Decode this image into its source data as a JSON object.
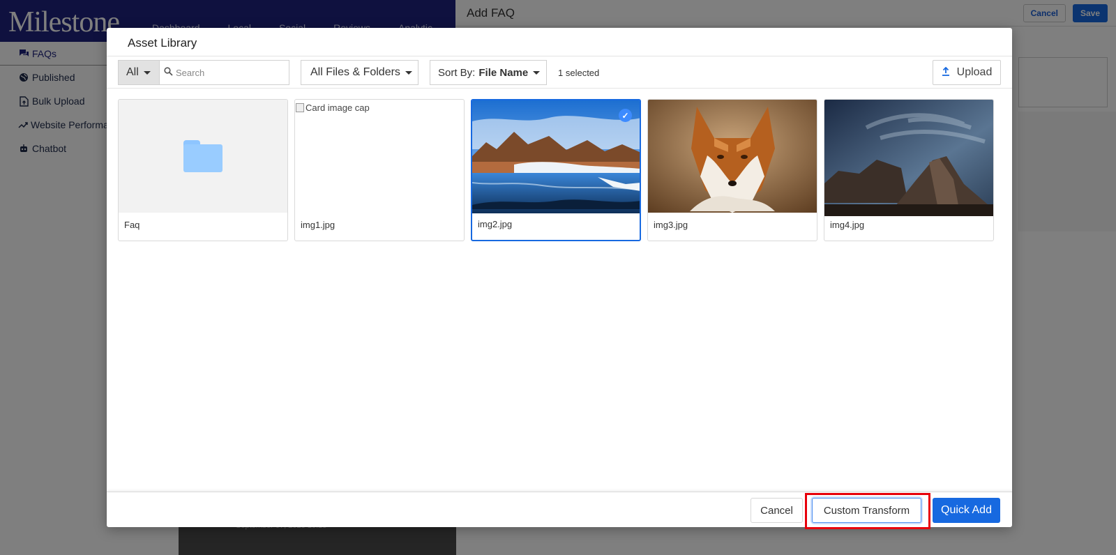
{
  "app": {
    "logo": "Milestone",
    "topnav": [
      "Dashboard",
      "Local",
      "Social",
      "Reviews",
      "Analytic"
    ],
    "sidebar": [
      {
        "label": "FAQs",
        "icon": "chat-icon"
      },
      {
        "label": "Published",
        "icon": "globe-icon"
      },
      {
        "label": "Bulk Upload",
        "icon": "file-upload-icon"
      },
      {
        "label": "Website Performan",
        "icon": "trending-icon"
      },
      {
        "label": "Chatbot",
        "icon": "robot-icon"
      }
    ],
    "faq_title": "Add FAQ",
    "faq_cancel": "Cancel",
    "faq_save": "Save",
    "bottom_text": "September 07, 2023 10:18"
  },
  "modal": {
    "title": "Asset Library",
    "filter_all": "All",
    "search_placeholder": "Search",
    "folder_filter": "All Files & Folders",
    "sort_prefix": "Sort By:",
    "sort_value": "File Name",
    "selected_count": "1 selected",
    "upload_label": "Upload",
    "assets": [
      {
        "name": "Faq",
        "kind": "folder"
      },
      {
        "name": "img1.jpg",
        "kind": "broken-image",
        "alt": "Card image cap"
      },
      {
        "name": "img2.jpg",
        "kind": "image",
        "selected": true
      },
      {
        "name": "img3.jpg",
        "kind": "image"
      },
      {
        "name": "img4.jpg",
        "kind": "image"
      }
    ],
    "footer": {
      "cancel": "Cancel",
      "custom_transform": "Custom Transform",
      "quick_add": "Quick Add"
    }
  },
  "colors": {
    "brand_navy": "#1f237f",
    "primary_blue": "#1769e0",
    "highlight_red": "#e8000b"
  }
}
